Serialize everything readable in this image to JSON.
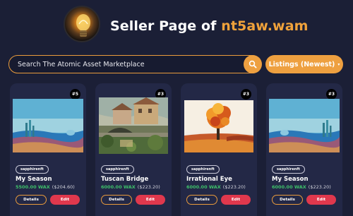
{
  "header": {
    "title_prefix": "Seller Page of ",
    "title_account": "nt5aw.wam",
    "logo_icon": "lightbulb-logo-icon"
  },
  "search": {
    "placeholder": "Search The Atomic Asset Marketplace",
    "button_icon": "search-icon"
  },
  "sort": {
    "label": "Listings (Newest)",
    "caret": "▾"
  },
  "colors": {
    "accent": "#eea040",
    "background": "#1b1f36",
    "card": "#232846",
    "price_green": "#3ec06a",
    "edit_red": "#e0384d"
  },
  "listings": [
    {
      "mint": "#5",
      "collection": "sapphirenft",
      "name": "My Season",
      "price_wax": "5500.00 WAX",
      "price_usd": "($204.60)",
      "details_label": "Details",
      "edit_label": "Edit"
    },
    {
      "mint": "#3",
      "collection": "sapphirenft",
      "name": "Tuscan Bridge",
      "price_wax": "6000.00 WAX",
      "price_usd": "($223.20)",
      "details_label": "Details",
      "edit_label": "Edit"
    },
    {
      "mint": "#3",
      "collection": "sapphirenft",
      "name": "Irrational Eye",
      "price_wax": "6000.00 WAX",
      "price_usd": "($223.20)",
      "details_label": "Details",
      "edit_label": "Edit"
    },
    {
      "mint": "#3",
      "collection": "sapphirenft",
      "name": "My Season",
      "price_wax": "6000.00 WAX",
      "price_usd": "($223.20)",
      "details_label": "Details",
      "edit_label": "Edit"
    }
  ]
}
